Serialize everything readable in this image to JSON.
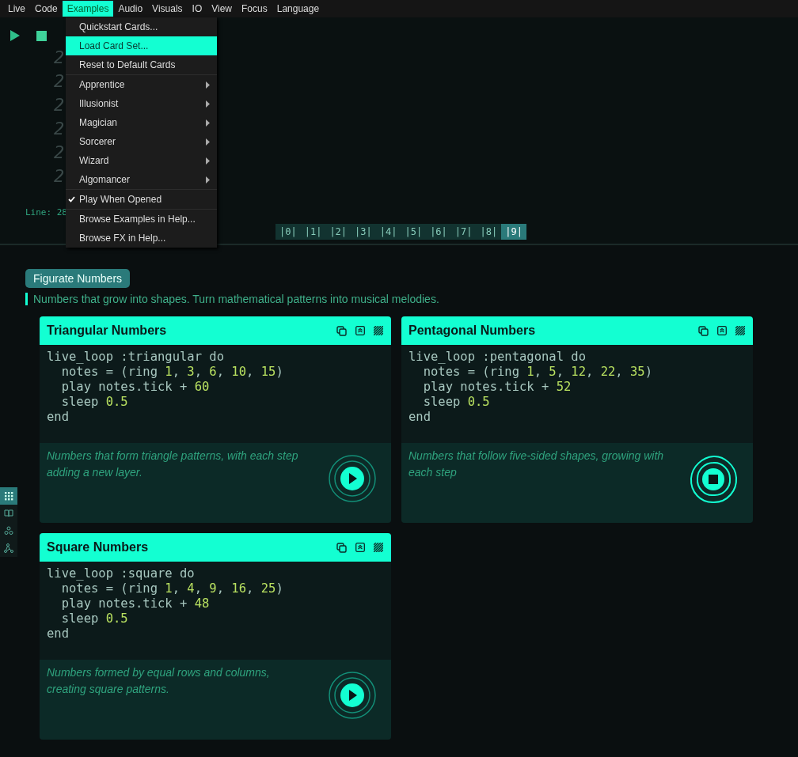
{
  "menubar": [
    {
      "label": "Live",
      "selected": false
    },
    {
      "label": "Code",
      "selected": false
    },
    {
      "label": "Examples",
      "selected": true
    },
    {
      "label": "Audio",
      "selected": false
    },
    {
      "label": "Visuals",
      "selected": false
    },
    {
      "label": "IO",
      "selected": false
    },
    {
      "label": "View",
      "selected": false
    },
    {
      "label": "Focus",
      "selected": false
    },
    {
      "label": "Language",
      "selected": false
    }
  ],
  "menu": {
    "groups": [
      [
        {
          "label": "Quickstart Cards...",
          "kind": "item",
          "selected": false
        },
        {
          "label": "Load Card Set...",
          "kind": "item",
          "selected": true
        },
        {
          "label": "Reset to Default Cards",
          "kind": "item",
          "selected": false
        }
      ],
      [
        {
          "label": "Apprentice",
          "kind": "submenu",
          "selected": false
        },
        {
          "label": "Illusionist",
          "kind": "submenu",
          "selected": false
        },
        {
          "label": "Magician",
          "kind": "submenu",
          "selected": false
        },
        {
          "label": "Sorcerer",
          "kind": "submenu",
          "selected": false
        },
        {
          "label": "Wizard",
          "kind": "submenu",
          "selected": false
        },
        {
          "label": "Algomancer",
          "kind": "submenu",
          "selected": false
        }
      ],
      [
        {
          "label": "Play When Opened",
          "kind": "check",
          "checked": true,
          "selected": false
        }
      ],
      [
        {
          "label": "Browse Examples in Help...",
          "kind": "item",
          "selected": false
        },
        {
          "label": "Browse FX in Help...",
          "kind": "item",
          "selected": false
        }
      ]
    ]
  },
  "editor": {
    "line_numbers": [
      "2",
      "2",
      "2",
      "2",
      "2",
      "2"
    ],
    "status": "Line: 28"
  },
  "buffer_tabs": [
    {
      "label": "|0|",
      "selected": false
    },
    {
      "label": "|1|",
      "selected": false
    },
    {
      "label": "|2|",
      "selected": false
    },
    {
      "label": "|3|",
      "selected": false
    },
    {
      "label": "|4|",
      "selected": false
    },
    {
      "label": "|5|",
      "selected": false
    },
    {
      "label": "|6|",
      "selected": false
    },
    {
      "label": "|7|",
      "selected": false
    },
    {
      "label": "|8|",
      "selected": false
    },
    {
      "label": "|9|",
      "selected": true
    }
  ],
  "side_tabs": [
    {
      "kind": "grid",
      "selected": true
    },
    {
      "kind": "book",
      "selected": false
    },
    {
      "kind": "nodes",
      "selected": false
    },
    {
      "kind": "graph",
      "selected": false
    }
  ],
  "section": {
    "title": "Figurate Numbers",
    "description": "Numbers that grow into shapes. Turn mathematical patterns into musical melodies."
  },
  "cards": [
    {
      "title": "Triangular Numbers",
      "code": [
        "live_loop :triangular do",
        "  notes = (ring 1, 3, 6, 10, 15)",
        "  play notes.tick + 60",
        "  sleep 0.5",
        "end"
      ],
      "description": "Numbers that form triangle patterns, with each step adding a new layer.",
      "playing": false
    },
    {
      "title": "Pentagonal Numbers",
      "code": [
        "live_loop :pentagonal do",
        "  notes = (ring 1, 5, 12, 22, 35)",
        "  play notes.tick + 52",
        "  sleep 0.5",
        "end"
      ],
      "description": "Numbers that follow five-sided shapes, growing with each step",
      "playing": true
    },
    {
      "title": "Square Numbers",
      "code": [
        "live_loop :square do",
        "  notes = (ring 1, 4, 9, 16, 25)",
        "  play notes.tick + 48",
        "  sleep 0.5",
        "end"
      ],
      "description": "Numbers formed by equal rows and columns, creating square patterns.",
      "playing": false
    }
  ]
}
